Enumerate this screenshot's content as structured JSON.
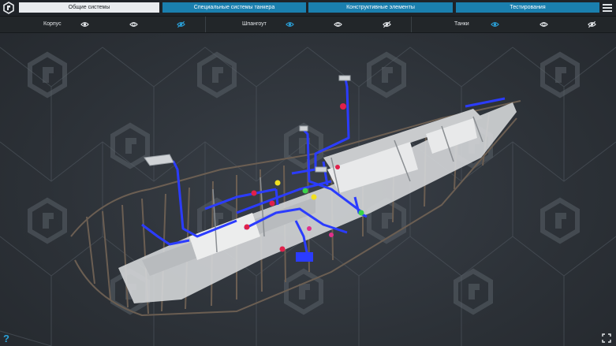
{
  "tabs": [
    {
      "label": "Общие системы",
      "active": true
    },
    {
      "label": "Специальные системы танкера",
      "active": false
    },
    {
      "label": "Конструктивные элементы",
      "active": false
    },
    {
      "label": "Тестирования",
      "active": false
    }
  ],
  "layers": [
    {
      "label": "Корпус",
      "icons": [
        "eye-icon",
        "eye-half-icon",
        "eye-off-icon"
      ]
    },
    {
      "label": "Шпангоут",
      "icons": [
        "eye-icon",
        "eye-half-icon",
        "eye-off-icon"
      ]
    },
    {
      "label": "Танки",
      "icons": [
        "eye-icon",
        "eye-half-icon",
        "eye-off-icon"
      ]
    }
  ],
  "help_label": "?",
  "colors": {
    "accent": "#1a7fae",
    "active_tab": "#e9ecef",
    "pipes": "#2b3cff",
    "background": "#2d3238"
  }
}
